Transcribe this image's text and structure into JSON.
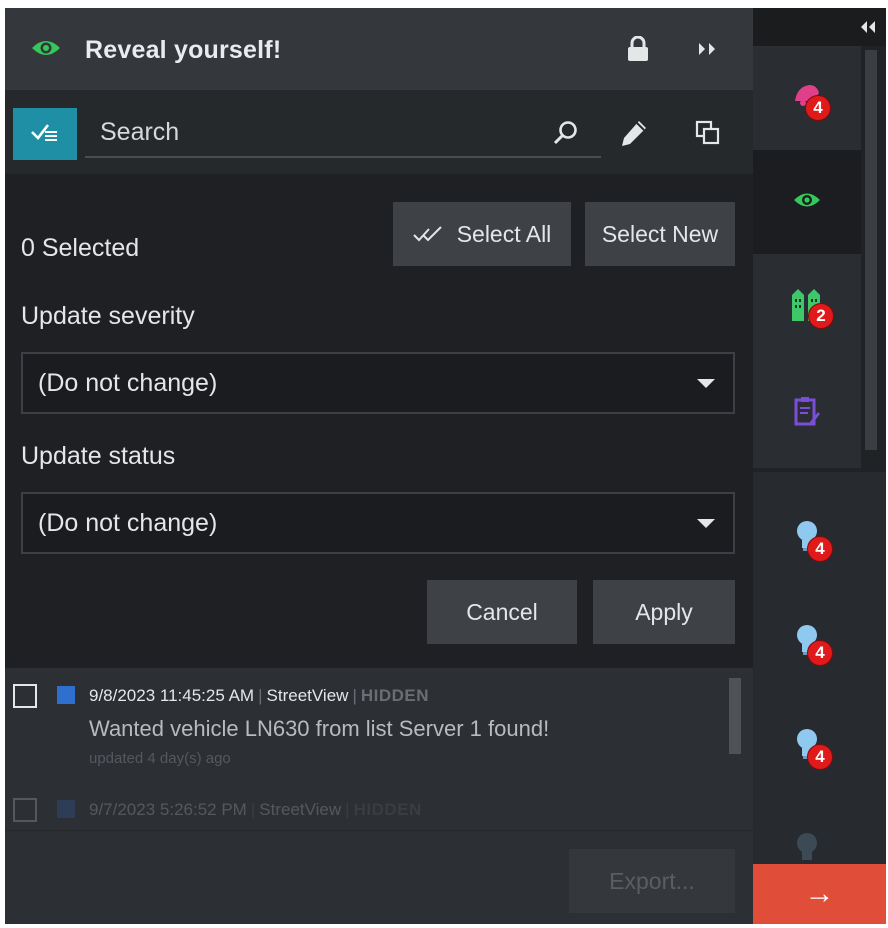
{
  "header": {
    "title": "Reveal yourself!",
    "icons": [
      "eye-icon",
      "lock-icon",
      "double-chevron-right-icon"
    ]
  },
  "search": {
    "placeholder": "Search",
    "icons": [
      "checklist-icon",
      "magnifier-icon",
      "pencil-icon",
      "copy-icon"
    ]
  },
  "selection": {
    "count_text": "0 Selected",
    "select_all_label": "Select All",
    "select_new_label": "Select New"
  },
  "severity": {
    "label": "Update severity",
    "value": "(Do not change)"
  },
  "status": {
    "label": "Update status",
    "value": "(Do not change)"
  },
  "actions": {
    "cancel_label": "Cancel",
    "apply_label": "Apply"
  },
  "events": [
    {
      "timestamp": "9/8/2023 11:45:25 AM",
      "source": "StreetView",
      "state": "HIDDEN",
      "message": "Wanted vehicle LN630 from list Server 1 found!",
      "updated": "updated 4 day(s) ago",
      "color": "#2e6fd0"
    },
    {
      "timestamp": "9/7/2023 5:26:52 PM",
      "source": "StreetView",
      "state": "HIDDEN",
      "color": "#2e6fd0"
    }
  ],
  "footer": {
    "export_label": "Export..."
  },
  "rail": {
    "items": [
      {
        "icon": "alarm-bell-icon",
        "badge": "4",
        "color": "#e0408a"
      },
      {
        "icon": "eye-icon",
        "badge": "",
        "color": "#35c85a"
      },
      {
        "icon": "buildings-icon",
        "badge": "2",
        "color": "#3ec86a"
      },
      {
        "icon": "clipboard-edit-icon",
        "badge": "",
        "color": "#7a4fd8"
      },
      {
        "icon": "lightbulb-icon",
        "badge": "4",
        "color": "#8fc9ef"
      },
      {
        "icon": "lightbulb-icon",
        "badge": "4",
        "color": "#8fc9ef"
      },
      {
        "icon": "lightbulb-icon",
        "badge": "4",
        "color": "#8fc9ef"
      }
    ],
    "collapse_icon": "double-chevron-left-icon",
    "go_icon": "arrow-right-icon",
    "go_label": "→"
  },
  "colors": {
    "accent_teal": "#1f8fa6",
    "eye_green": "#35c85a",
    "badge_red": "#e01a1a",
    "go_orange": "#e04e39"
  }
}
